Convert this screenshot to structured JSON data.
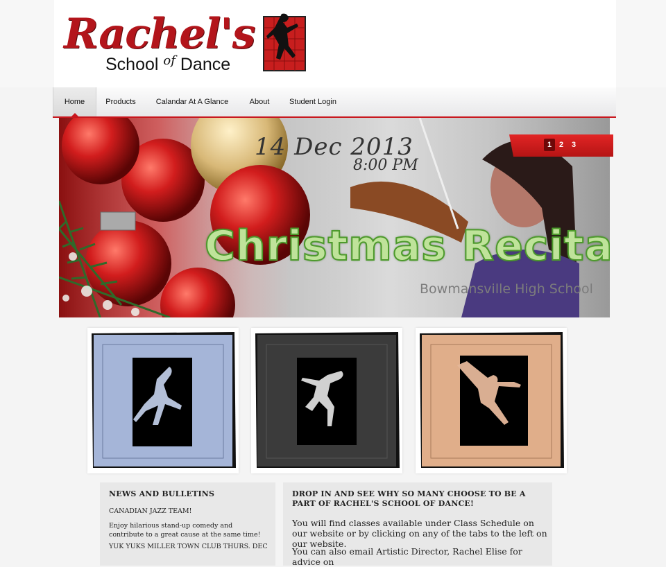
{
  "site": {
    "logo_script": "Rachel's",
    "logo_subtitle_1": "School",
    "logo_subtitle_of": "of",
    "logo_subtitle_2": "Dance"
  },
  "nav": {
    "items": [
      {
        "label": "Home",
        "active": true
      },
      {
        "label": "Products"
      },
      {
        "label": "Calandar At A Glance"
      },
      {
        "label": "About"
      },
      {
        "label": "Student Login"
      }
    ]
  },
  "banner": {
    "date": "14 Dec 2013",
    "time": "8:00 PM",
    "title": "Christmas Recital",
    "venue": "Bowmansville High School",
    "slides": [
      "1",
      "2",
      "3"
    ],
    "active_slide": "1"
  },
  "cards": [
    {
      "name": "dancer-card-blue",
      "bg": "#a5b5d8",
      "figure": "#c7d4ee"
    },
    {
      "name": "dancer-card-dark",
      "bg": "#3b3b3b",
      "figure": "#dcdcdc"
    },
    {
      "name": "dancer-card-peach",
      "bg": "#e0ae8a",
      "figure": "#e5b79a"
    }
  ],
  "news": {
    "heading": "NEWS AND BULLETINS",
    "item1": "CANADIAN JAZZ TEAM!",
    "item2": "Enjoy hilarious stand-up comedy and contribute to a great cause at the same time!",
    "item3": "YUK YUKS MILLER TOWN CLUB THURS. DEC"
  },
  "dropin": {
    "heading": "DROP IN AND SEE WHY SO MANY CHOOSE TO BE A PART OF RACHEL'S SCHOOL OF DANCE!",
    "para1": "You will find classes available under Class Schedule on our website or by clicking on any of the tabs to the left on our website.",
    "para2": "You can also email Artistic Director, Rachel Elise for advice on"
  },
  "colors": {
    "accent": "#c8161d",
    "panel_bg": "#e8e8e8",
    "page_bg": "#f4f4f4"
  }
}
